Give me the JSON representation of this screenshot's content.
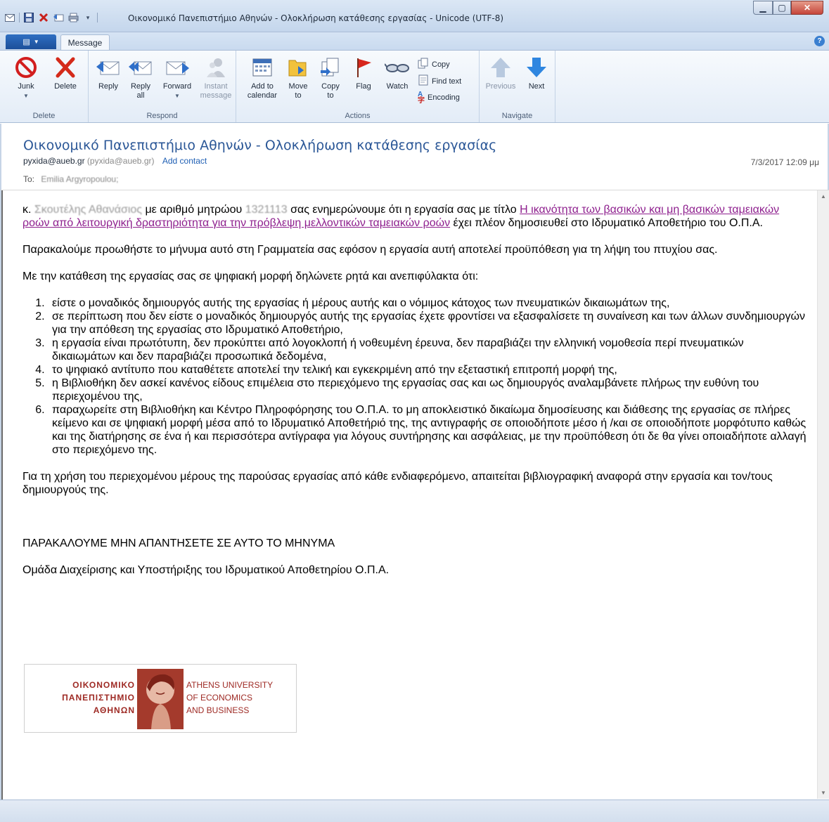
{
  "window": {
    "title": "Οικονομικό Πανεπιστήμιο Αθηνών - Ολοκλήρωση κατάθεσης εργασίας - Unicode (UTF-8)"
  },
  "tabs": {
    "message": "Message"
  },
  "ribbon": {
    "delete_group": {
      "label": "Delete",
      "junk": "Junk",
      "delete": "Delete"
    },
    "respond_group": {
      "label": "Respond",
      "reply": "Reply",
      "reply_all_1": "Reply",
      "reply_all_2": "all",
      "forward": "Forward",
      "instant_1": "Instant",
      "instant_2": "message"
    },
    "actions_group": {
      "label": "Actions",
      "add_cal_1": "Add to",
      "add_cal_2": "calendar",
      "move_1": "Move",
      "move_2": "to",
      "copy_to_1": "Copy",
      "copy_to_2": "to",
      "flag": "Flag",
      "watch": "Watch",
      "copy": "Copy",
      "find_text": "Find text",
      "encoding": "Encoding"
    },
    "navigate_group": {
      "label": "Navigate",
      "previous": "Previous",
      "next": "Next"
    }
  },
  "header": {
    "subject": "Οικονομικό Πανεπιστήμιο Αθηνών - Ολοκλήρωση κατάθεσης εργασίας",
    "from_email": "pyxida@aueb.gr",
    "from_paren": "(pyxida@aueb.gr)",
    "add_contact": "Add contact",
    "date": "7/3/2017 12:09 μμ",
    "to_label": "To:",
    "to_value": "Emilia Argyropoulou;"
  },
  "body": {
    "p1_prefix": "κ.",
    "p1_name": "Σκουτέλης Αθανάσιος",
    "p1_mid": "με αριθμό μητρώου",
    "p1_id": "1321113",
    "p1_mid2": "σας ενημερώνουμε ότι η εργασία σας με τίτλο",
    "p1_title_link": "Η ικανότητα των βασικών και μη βασικών ταμειακών ροών από λειτουργική δραστηριότητα για την πρόβλεψη μελλοντικών ταμειακών ροών",
    "p1_end": "έχει πλέον δημοσιευθεί στο Ιδρυματικό Αποθετήριο του Ο.Π.Α.",
    "p2": "Παρακαλούμε προωθήστε το μήνυμα αυτό στη Γραμματεία σας εφόσον η εργασία αυτή αποτελεί προϋπόθεση για τη λήψη του πτυχίου σας.",
    "p3": "Με την κατάθεση της εργασίας σας σε ψηφιακή μορφή δηλώνετε ρητά και ανεπιφύλακτα ότι:",
    "items": [
      "είστε ο μοναδικός δημιουργός αυτής της εργασίας ή μέρους αυτής και ο νόμιμος κάτοχος των πνευματικών δικαιωμάτων της,",
      "σε περίπτωση που δεν είστε ο μοναδικός δημιουργός αυτής της εργασίας έχετε φροντίσει να εξασφαλίσετε τη συναίνεση και των άλλων συνδημιουργών για την απόθεση της εργασίας στο Ιδρυματικό Αποθετήριο,",
      "η εργασία είναι πρωτότυπη, δεν προκύπτει από λογοκλοπή ή νοθευμένη έρευνα, δεν παραβιάζει την ελληνική νομοθεσία περί πνευματικών δικαιωμάτων και δεν παραβιάζει προσωπικά δεδομένα,",
      "το ψηφιακό αντίτυπο που καταθέτετε αποτελεί την τελική και εγκεκριμένη από την εξεταστική επιτροπή μορφή της,",
      "η Βιβλιοθήκη δεν ασκεί κανένος είδους επιμέλεια στο περιεχόμενο της εργασίας σας και ως δημιουργός αναλαμβάνετε πλήρως την ευθύνη του περιεχομένου της,",
      "παραχωρείτε στη Βιβλιοθήκη και Κέντρο Πληροφόρησης του Ο.Π.Α. το μη αποκλειστικό δικαίωμα δημοσίευσης και διάθεσης της εργασίας σε πλήρες κείμενο και σε ψηφιακή μορφή μέσα από το Ιδρυματικό Αποθετήριό της, της αντιγραφής σε οποιοδήποτε μέσο ή /και σε οποιοδήποτε μορφότυπο καθώς και της διατήρησης σε ένα ή και περισσότερα αντίγραφα για λόγους συντήρησης και ασφάλειας, με την προϋπόθεση ότι δε θα γίνει οποιαδήποτε αλλαγή στο περιεχόμενο της."
    ],
    "p4": "Για τη χρήση του περιεχομένου μέρους της παρούσας εργασίας από κάθε ενδιαφερόμενο, απαιτείται βιβλιογραφική αναφορά στην εργασία και τον/τους δημιουργούς της.",
    "p5": "ΠΑΡΑΚΑΛΟΥΜΕ ΜΗΝ ΑΠΑΝΤΗΣΕΤΕ ΣΕ ΑΥΤΟ ΤΟ ΜΗΝΥΜΑ",
    "p6": "Ομάδα Διαχείρισης και Υποστήριξης του Ιδρυματικού Αποθετηρίου Ο.Π.Α."
  },
  "logo": {
    "gr_1": "ΟΙΚΟΝΟΜΙΚΟ",
    "gr_2": "ΠΑΝΕΠΙΣΤΗΜΙΟ",
    "gr_3": "ΑΘΗΝΩΝ",
    "en_1": "ATHENS UNIVERSITY",
    "en_2": "OF ECONOMICS",
    "en_3": "AND BUSINESS"
  },
  "colors": {
    "subject": "#2b5797",
    "link": "#1f5fb4",
    "thesis_link": "#8e1f8e",
    "logo": "#9e2a24"
  }
}
